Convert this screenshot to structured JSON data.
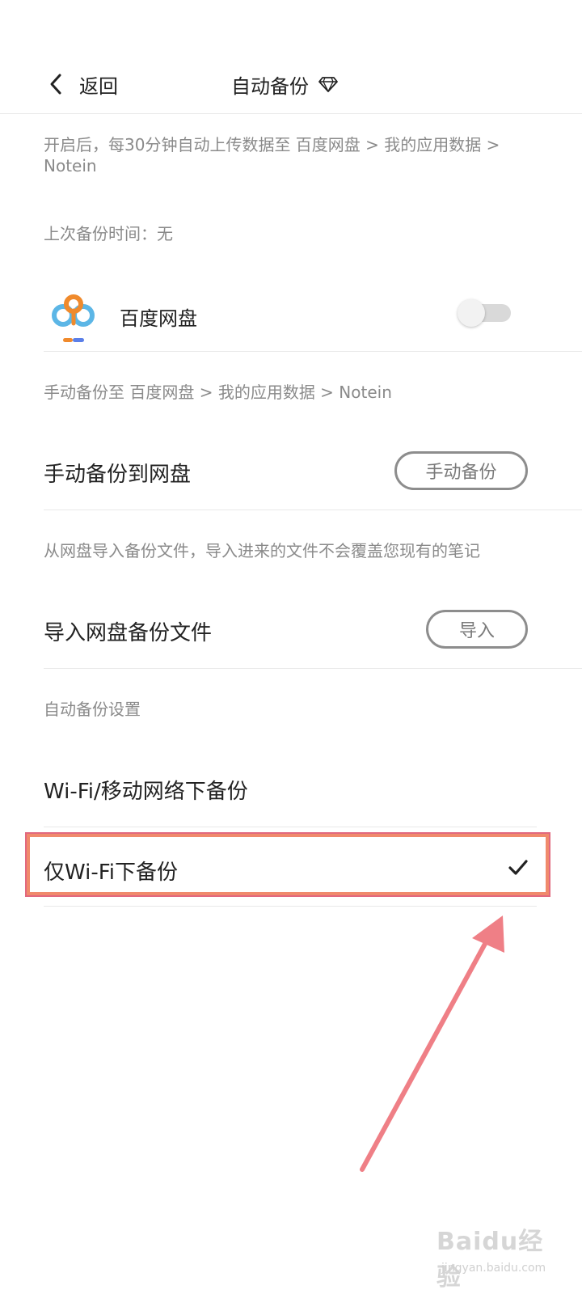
{
  "header": {
    "back_label": "返回",
    "title": "自动备份",
    "title_icon": "diamond-icon",
    "back_icon": "chevron-left-icon"
  },
  "auto_backup": {
    "description": "开启后，每30分钟自动上传数据至 百度网盘 > 我的应用数据 > Notein",
    "last_backup": "上次备份时间：无",
    "service_icon": "baidu-netdisk-logo",
    "service_label": "百度网盘",
    "enabled": false
  },
  "manual_backup": {
    "description": "手动备份至 百度网盘 > 我的应用数据 > Notein",
    "label": "手动备份到网盘",
    "button": "手动备份"
  },
  "import_backup": {
    "description": "从网盘导入备份文件，导入进来的文件不会覆盖您现有的笔记",
    "label": "导入网盘备份文件",
    "button": "导入"
  },
  "backup_settings": {
    "section_title": "自动备份设置",
    "options": [
      {
        "label": "Wi-Fi/移动网络下备份",
        "selected": false
      },
      {
        "label": "仅Wi-Fi下备份",
        "selected": true
      }
    ],
    "check_icon": "checkmark-icon"
  },
  "watermark": {
    "main": "Baidu经验",
    "sub": "jingyan.baidu.com"
  },
  "colors": {
    "highlight_border": "#f08a6c",
    "arrow": "#ef7f86",
    "button_border": "#8d8d8d",
    "secondary_text": "#8a8a8a"
  }
}
